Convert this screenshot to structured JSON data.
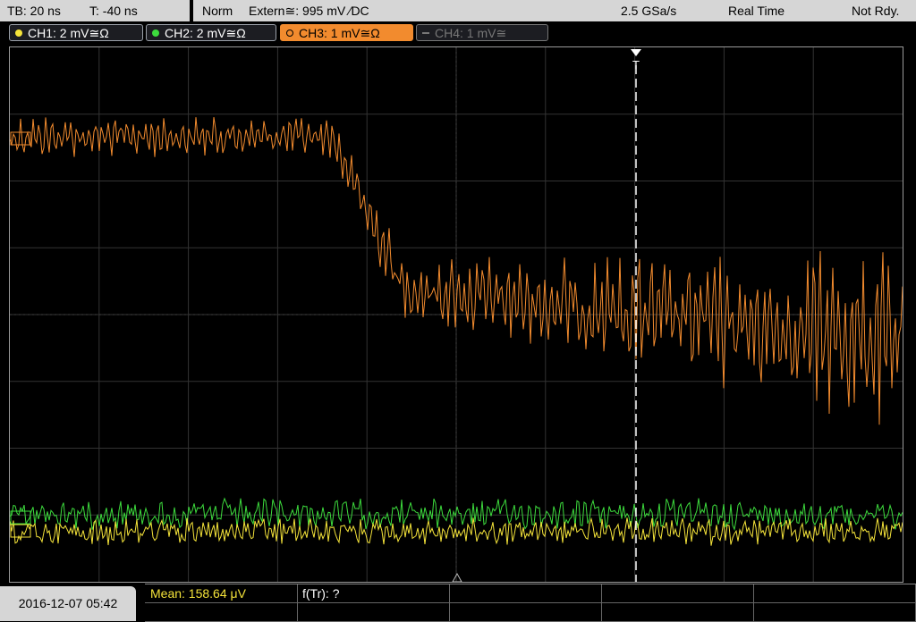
{
  "topbar": {
    "timebase": "TB: 20 ns",
    "trigger_time": "T: -40 ns",
    "trigger_mode": "Norm",
    "trigger_source": "Extern≅: 995 mV ∕DC",
    "sample_rate": "2.5 GSa/s",
    "acq_mode": "Real Time",
    "status": "Not Rdy."
  },
  "channels": [
    {
      "label": "CH1: 2 mV≅Ω",
      "color": "#f5e43a",
      "active": false,
      "enabled": true
    },
    {
      "label": "CH2: 2 mV≅Ω",
      "color": "#3ddc3d",
      "active": false,
      "enabled": true
    },
    {
      "label": "CH3: 1 mV≅Ω",
      "color": "#f28b2e",
      "active": true,
      "enabled": true
    },
    {
      "label": "CH4: 1 mV≅",
      "color": "#777777",
      "active": false,
      "enabled": false
    }
  ],
  "trigger_marker": "T",
  "timestamp": "2016-12-07 05:42",
  "measurements": [
    {
      "label": "Mean: 158.64 μV",
      "color": "#f5e43a"
    },
    {
      "label": "f(Tr): ?",
      "color": "#ffffff"
    }
  ],
  "colors": {
    "ch1": "#f5e43a",
    "ch2": "#3ddc3d",
    "ch3": "#f28b2e",
    "grid": "#3a3a3a"
  }
}
